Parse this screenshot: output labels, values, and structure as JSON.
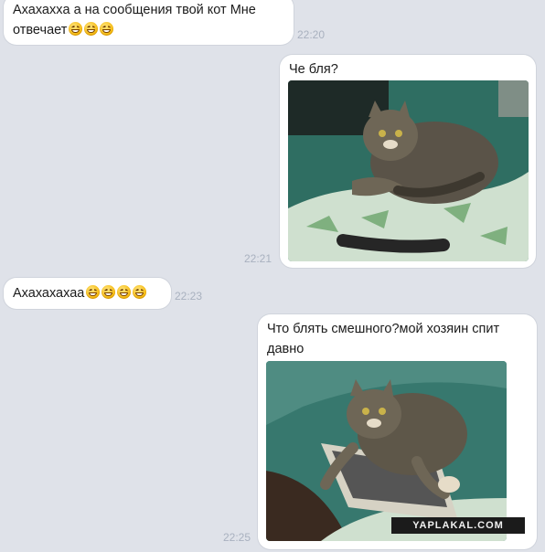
{
  "messages": [
    {
      "text": "Ахахаххa а на сообщения твой кот Мне отвечает",
      "line1": "Ахахаххa а на сообщения твой кот Мне",
      "line2": "отвечает",
      "emoji": "smiling-face",
      "emoji_count": 3,
      "time": "22:20",
      "side": "left"
    },
    {
      "text": "Че бля?",
      "time": "22:21",
      "side": "right",
      "photo": "cat-on-couch"
    },
    {
      "text": "Ахахахахаа",
      "emoji": "smiling-face",
      "emoji_count": 4,
      "time": "22:23",
      "side": "left"
    },
    {
      "line1": "Что блять смешного?мой хозяин спит",
      "line2": "давно",
      "time": "22:25",
      "side": "right",
      "photo": "cat-on-keyboard"
    }
  ],
  "watermark": "YAPLAKAL.COM",
  "colors": {
    "background": "#dfe2e9",
    "bubble": "#ffffff",
    "time": "#a9b1bf"
  }
}
